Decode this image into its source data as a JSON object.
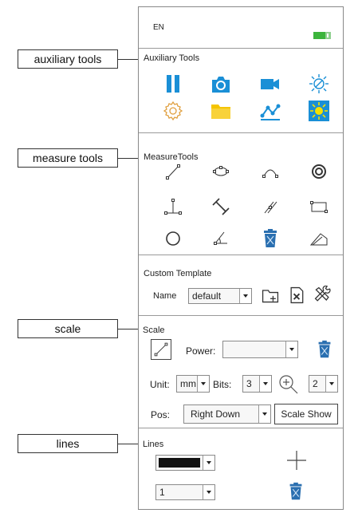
{
  "callouts": {
    "auxiliary": "auxiliary tools",
    "measure": "measure tools",
    "scale": "scale",
    "lines": "lines"
  },
  "status": {
    "language": "EN",
    "battery_color": "#3cb43c"
  },
  "auxiliary": {
    "title": "Auxiliary Tools",
    "icons": [
      "pause-icon",
      "camera-icon",
      "video-icon",
      "white-balance-icon",
      "settings-icon",
      "folder-icon",
      "graph-icon",
      "brightness-icon"
    ]
  },
  "measure": {
    "title": "MeasureTools",
    "icons": [
      "line-icon",
      "ellipse-icon",
      "arc-icon",
      "concentric-circle-icon",
      "perpendicular-icon",
      "parallel-distance-icon",
      "parallel-lines-icon",
      "rectangle-icon",
      "circle-icon",
      "angle-icon",
      "delete-icon",
      "polygon-icon"
    ]
  },
  "template": {
    "title": "Custom Template",
    "name_label": "Name",
    "name_value": "default"
  },
  "scale": {
    "title": "Scale",
    "power_label": "Power:",
    "power_value": "",
    "unit_label": "Unit:",
    "unit_value": "mm",
    "bits_label": "Bits:",
    "bits_value": "3",
    "zoom_value": "2",
    "pos_label": "Pos:",
    "pos_value": "Right Down",
    "show_button": "Scale Show"
  },
  "lines": {
    "title": "Lines",
    "color_value": "#111111",
    "width_value": "1"
  },
  "colors": {
    "accent_blue": "#1a8fd6",
    "folder_yellow": "#f5c400",
    "trash_blue": "#2a6fb0"
  }
}
